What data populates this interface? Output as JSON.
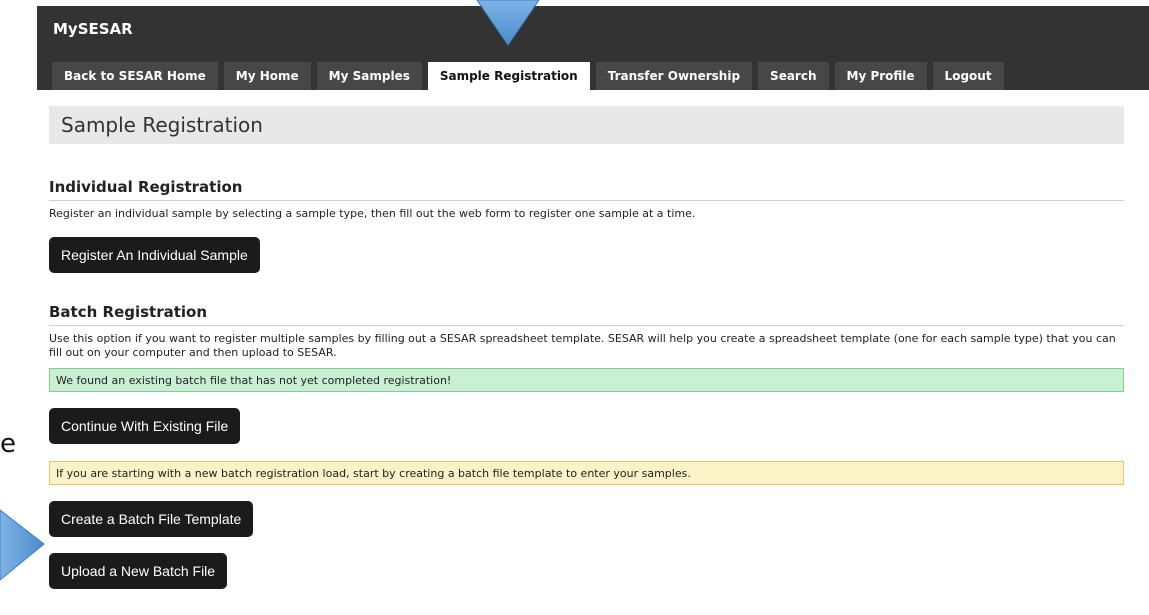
{
  "app": {
    "title": "MySESAR"
  },
  "tabs": [
    {
      "label": "Back to SESAR Home",
      "active": false
    },
    {
      "label": "My Home",
      "active": false
    },
    {
      "label": "My Samples",
      "active": false
    },
    {
      "label": "Sample Registration",
      "active": true
    },
    {
      "label": "Transfer Ownership",
      "active": false
    },
    {
      "label": "Search",
      "active": false
    },
    {
      "label": "My Profile",
      "active": false
    },
    {
      "label": "Logout",
      "active": false
    }
  ],
  "page": {
    "title": "Sample Registration"
  },
  "individual": {
    "heading": "Individual Registration",
    "description": "Register an individual sample by selecting a sample type, then fill out the web form to register one sample at a time.",
    "button": "Register An Individual Sample"
  },
  "batch": {
    "heading": "Batch Registration",
    "description": "Use this option if you want to register multiple samples by filling out a SESAR spreadsheet template. SESAR will help you create a spreadsheet template (one for each sample type) that you can fill out on your computer and then upload to SESAR.",
    "existing_notice": "We found an existing batch file that has not yet completed registration!",
    "continue_button": "Continue With Existing File",
    "new_notice": "If you are starting with a new batch registration load, start by creating a batch file template to enter your samples.",
    "create_button": "Create a Batch File Template",
    "upload_button": "Upload a New Batch File"
  },
  "annotation": {
    "stray_letter": "e"
  },
  "colors": {
    "topbar": "#333333",
    "tab": "#474747",
    "button": "#1b1b1b",
    "success_bg": "#c9f0d3",
    "info_bg": "#fbf2c7",
    "pointer": "#5b9bd5"
  },
  "icons": {
    "down_pointer": "arrow-down-icon",
    "right_pointer": "arrow-right-icon"
  }
}
